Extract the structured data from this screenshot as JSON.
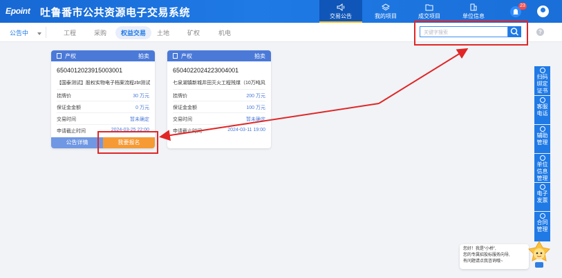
{
  "header": {
    "logo": "Epoint",
    "title": "吐鲁番市公共资源电子交易系统",
    "nav": [
      {
        "label": "交易公告",
        "active": true
      },
      {
        "label": "我的项目",
        "active": false
      },
      {
        "label": "成交项目",
        "active": false
      },
      {
        "label": "单位信息",
        "active": false
      }
    ],
    "notification_count": "23"
  },
  "subnav": {
    "status": "公告中",
    "categories": [
      {
        "label": "工程"
      },
      {
        "label": "采购"
      },
      {
        "label": "权益交易"
      },
      {
        "label": "土地"
      },
      {
        "label": "矿权"
      },
      {
        "label": "机电"
      }
    ],
    "search_placeholder": "关键字搜索",
    "help": "?"
  },
  "cards": [
    {
      "type": "产权",
      "mode": "拍卖",
      "code": "6504012023915003001",
      "name": "【国泰测试】股权实物电子档案流程zbt测试",
      "rows": [
        {
          "label": "挂牌价",
          "value": "30 万元"
        },
        {
          "label": "保证金金额",
          "value": "0 万元"
        },
        {
          "label": "交易时间",
          "value": "暂未确定"
        },
        {
          "label": "申请截止时间",
          "value": "2024-03-25 22:00"
        }
      ],
      "btn_detail": "公告详情",
      "btn_signup": "我要报名"
    },
    {
      "type": "产权",
      "mode": "拍卖",
      "code": "6504022024223004001",
      "name": "七泉湖镇新城井田灭火工程残煤（10万吨风",
      "rows": [
        {
          "label": "挂牌价",
          "value": "200 万元"
        },
        {
          "label": "保证金金额",
          "value": "100 万元"
        },
        {
          "label": "交易时间",
          "value": "暂未确定"
        },
        {
          "label": "申请截止时间",
          "value": "2024-03-11 19:00"
        }
      ]
    }
  ],
  "sidebar": [
    {
      "label": "扫码绑定证书"
    },
    {
      "label": "客服电话"
    },
    {
      "label": "辅助管理"
    },
    {
      "label": "单位信息管理"
    },
    {
      "label": "电子发票"
    },
    {
      "label": "合同管理"
    }
  ],
  "chat": {
    "line1": "您好！我是“小桥”,",
    "line2": "您的专属招投标服务向导,",
    "line3": "有问题请点我咨询哦~"
  },
  "colors": {
    "header_blue": "#1f7ae6",
    "card_head": "#4a79d8",
    "signup_orange": "#f59a35",
    "annotation_red": "#e12525"
  }
}
